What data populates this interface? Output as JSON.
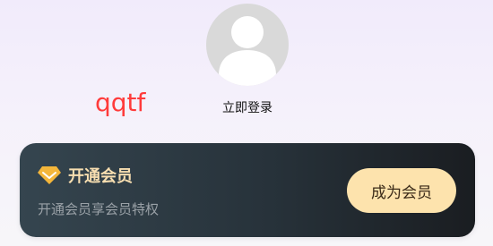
{
  "profile": {
    "username": "qqtf",
    "login_label": "立即登录",
    "avatar_icon": "default-avatar-icon"
  },
  "vip_card": {
    "title": "开通会员",
    "subtitle": "开通会员享会员特权",
    "button_label": "成为会员",
    "icon": "diamond-icon",
    "colors": {
      "card_start": "#35454f",
      "card_end": "#1a1d21",
      "gold": "#f4b63a",
      "title": "#f7deb0",
      "button_bg": "#fde3ad"
    }
  },
  "colors": {
    "username": "#ff3b3b"
  }
}
